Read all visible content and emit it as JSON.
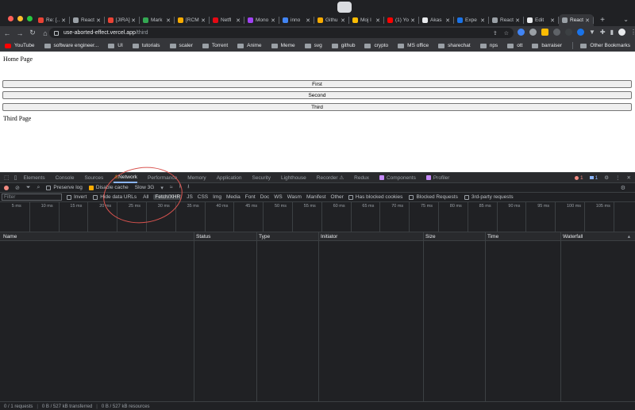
{
  "browser": {
    "tabs": [
      {
        "label": "Re: [...",
        "color": "#ea4335"
      },
      {
        "label": "React",
        "color": "#9aa0a6"
      },
      {
        "label": "[JIRA]",
        "color": "#ea4335"
      },
      {
        "label": "Mark",
        "color": "#34a853"
      },
      {
        "label": "[RCM",
        "color": "#f9ab00"
      },
      {
        "label": "Netfl",
        "color": "#e50914"
      },
      {
        "label": "Mono",
        "color": "#a142f4"
      },
      {
        "label": "inno",
        "color": "#4285f4"
      },
      {
        "label": "Githu",
        "color": "#f9ab00"
      },
      {
        "label": "Moj l",
        "color": "#fbbc04"
      },
      {
        "label": "(1) Yo",
        "color": "#ff0000"
      },
      {
        "label": "Akas",
        "color": "#e8eaed"
      },
      {
        "label": "Expe",
        "color": "#1a73e8"
      },
      {
        "label": "React",
        "color": "#9aa0a6"
      },
      {
        "label": "Edit",
        "color": "#e8eaed"
      },
      {
        "label": "React",
        "color": "#9aa0a6",
        "active": true
      }
    ],
    "url_host": "use-aborted-effect.vercel.app",
    "url_path": "/third",
    "bookmarks": [
      "YouTube",
      "software engineer...",
      "UI",
      "tutorials",
      "scaler",
      "Torrent",
      "Anime",
      "Meme",
      "svg",
      "github",
      "crypto",
      "MS office",
      "sharechat",
      "nps",
      "ott",
      "barraiser"
    ],
    "other_bookmarks": "Other Bookmarks"
  },
  "page": {
    "home_title": "Home Page",
    "buttons": [
      "First",
      "Second",
      "Third"
    ],
    "third_title": "Third Page"
  },
  "devtools": {
    "tabs": [
      "Elements",
      "Console",
      "Sources",
      "Network",
      "Performance",
      "Memory",
      "Application",
      "Security",
      "Lighthouse",
      "Recorder ⚠",
      "Redux",
      "Components",
      "Profiler"
    ],
    "active_tab": "Network",
    "error_count": "1",
    "message_count": "1",
    "preserve_log": "Preserve log",
    "disable_cache": "Disable cache",
    "throttling": "Slow 3G",
    "filter_placeholder": "Filter",
    "invert": "Invert",
    "hide_data_urls": "Hide data URLs",
    "types": [
      "All",
      "Fetch/XHR",
      "JS",
      "CSS",
      "Img",
      "Media",
      "Font",
      "Doc",
      "WS",
      "Wasm",
      "Manifest",
      "Other"
    ],
    "active_type": "Fetch/XHR",
    "has_blocked_cookies": "Has blocked cookies",
    "blocked_requests": "Blocked Requests",
    "third_party": "3rd-party requests",
    "timeline_ticks": [
      "5 ms",
      "10 ms",
      "15 ms",
      "20 ms",
      "25 ms",
      "30 ms",
      "35 ms",
      "40 ms",
      "45 ms",
      "50 ms",
      "55 ms",
      "60 ms",
      "65 ms",
      "70 ms",
      "75 ms",
      "80 ms",
      "85 ms",
      "90 ms",
      "95 ms",
      "100 ms",
      "105 ms"
    ],
    "columns": [
      "Name",
      "Status",
      "Type",
      "Initiator",
      "Size",
      "Time",
      "Waterfall"
    ],
    "status": {
      "requests": "0 / 1 requests",
      "transferred": "0 B / 527 kB transferred",
      "resources": "0 B / 527 kB resources"
    }
  }
}
